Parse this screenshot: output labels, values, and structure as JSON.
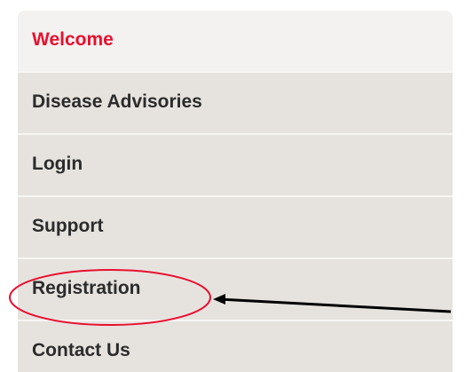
{
  "nav": {
    "items": [
      {
        "label": "Welcome",
        "active": true
      },
      {
        "label": "Disease Advisories",
        "active": false
      },
      {
        "label": "Login",
        "active": false
      },
      {
        "label": "Support",
        "active": false
      },
      {
        "label": "Registration",
        "active": false
      },
      {
        "label": "Contact Us",
        "active": false
      }
    ]
  },
  "colors": {
    "active_text": "#e8102f",
    "item_bg": "#e6e3df",
    "active_bg": "#f3f2f0",
    "annotation_ellipse": "#e8102f",
    "annotation_arrow": "#000000"
  }
}
